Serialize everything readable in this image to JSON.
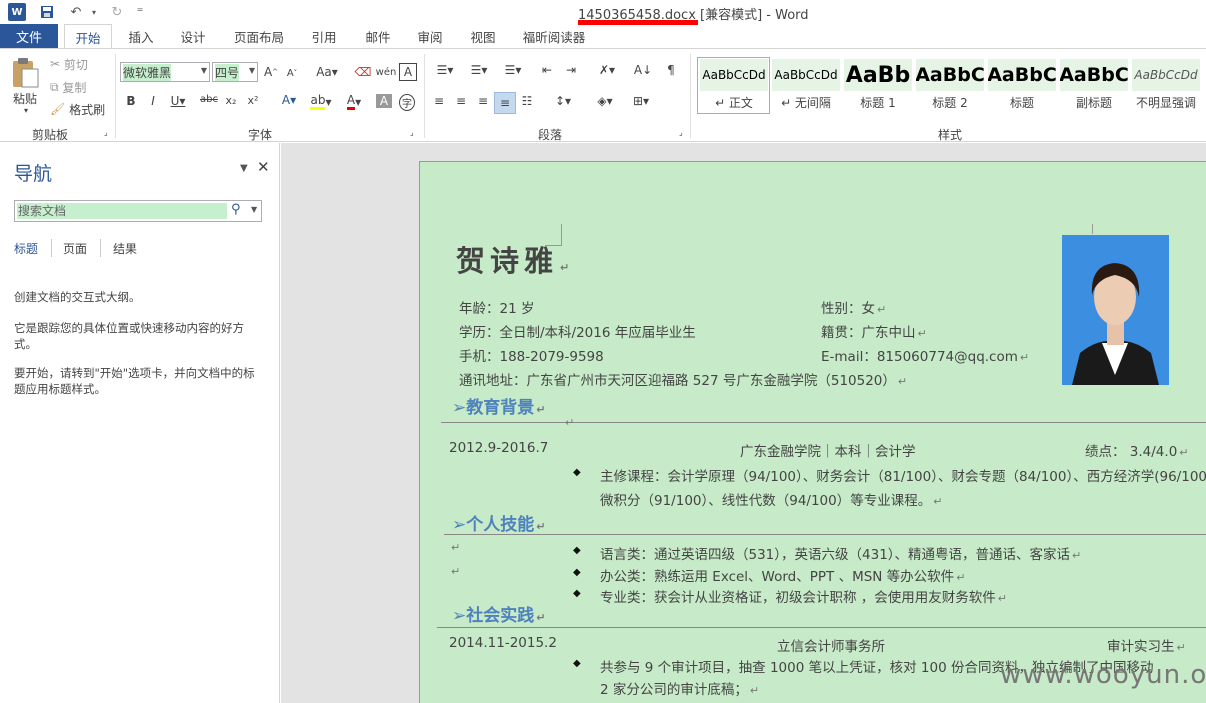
{
  "window": {
    "title": "1450365458.docx [兼容模式] - Word"
  },
  "quick_access": {
    "undo_label": "↶",
    "redo_label": "↻",
    "customize_label": "⁼"
  },
  "tabs": [
    {
      "label": "文件"
    },
    {
      "label": "开始"
    },
    {
      "label": "插入"
    },
    {
      "label": "设计"
    },
    {
      "label": "页面布局"
    },
    {
      "label": "引用"
    },
    {
      "label": "邮件"
    },
    {
      "label": "审阅"
    },
    {
      "label": "视图"
    },
    {
      "label": "福昕阅读器"
    }
  ],
  "clipboard": {
    "paste": "粘贴",
    "cut": "剪切",
    "copy": "复制",
    "format_painter": "格式刷",
    "group": "剪贴板"
  },
  "font": {
    "name": "微软雅黑",
    "size": "四号",
    "group": "字体"
  },
  "paragraph": {
    "group": "段落"
  },
  "styles": {
    "group": "样式",
    "items": [
      {
        "sample": "AaBbCcDd",
        "name": "↵ 正文"
      },
      {
        "sample": "AaBbCcDd",
        "name": "↵ 无间隔"
      },
      {
        "sample": "AaBb",
        "name": "标题 1"
      },
      {
        "sample": "AaBbC",
        "name": "标题 2"
      },
      {
        "sample": "AaBbC",
        "name": "标题"
      },
      {
        "sample": "AaBbC",
        "name": "副标题"
      },
      {
        "sample": "AaBbCcDd",
        "name": "不明显强调"
      }
    ]
  },
  "navigation": {
    "title": "导航",
    "search_placeholder": "搜索文档",
    "tabs": [
      "标题",
      "页面",
      "结果"
    ],
    "help": [
      "创建文档的交互式大纲。",
      "它是跟踪您的具体位置或快速移动内容的好方式。",
      "要开始，请转到\"开始\"选项卡，并向文档中的标题应用标题样式。"
    ]
  },
  "resume": {
    "name": "贺诗雅",
    "age": "年龄：21 岁",
    "gender": "性别：女",
    "education": "学历：全日制/本科/2016 年应届毕业生",
    "hometown": "籍贯：广东中山",
    "phone": "手机：188-2079-9598",
    "email": "E-mail：815060774@qq.com",
    "address": "通讯地址：广东省广州市天河区迎福路 527 号广东金融学院（510520）",
    "sections": {
      "education": "➢教育背景",
      "skills": "➢个人技能",
      "practice": "➢社会实践"
    },
    "edu_period": "2012.9-2016.7",
    "edu_school": "广东金融学院｜本科｜会计学",
    "edu_gpa": "绩点：  3.4/4.0",
    "edu_courses_1": "主修课程：会计学原理（94/100）、财务会计（81/100）、财会专题（84/100）、西方经济学(96/100)",
    "edu_courses_2": "微积分（91/100）、线性代数（94/100）等专业课程。",
    "skill_lang": "语言类：通过英语四级（531），英语六级（431）、精通粤语，普通话、客家话",
    "skill_office": "办公类：熟练运用 Excel、Word、PPT 、MSN 等办公软件",
    "skill_pro": "专业类：获会计从业资格证，初级会计职称 ，会使用用友财务软件",
    "work_period": "2014.11-2015.2",
    "work_company": "立信会计师事务所",
    "work_role": "审计实习生",
    "work_desc_1": "共参与 9 个审计项目，抽查 1000 笔以上凭证，核对 100 份合同资料，独立编制了中国移动",
    "work_desc_2": "2 家分公司的审计底稿；",
    "watermark": "www.wooyun.org"
  }
}
